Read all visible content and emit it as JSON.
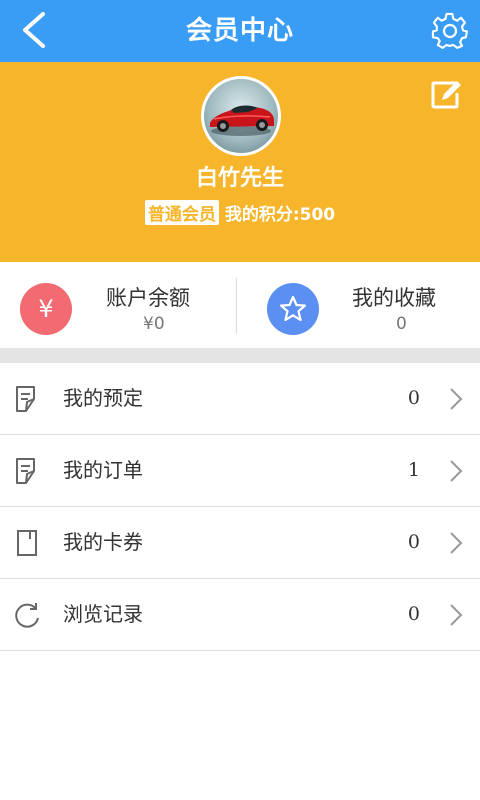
{
  "header": {
    "title": "会员中心",
    "back_icon": "chevron-left-icon",
    "settings_icon": "gear-icon",
    "bg_color": "#3a9df5"
  },
  "profile": {
    "bg_color": "#f7b52c",
    "username": "白竹先生",
    "member_level": "普通会员",
    "points_text": "我的积分:500",
    "edit_icon": "edit-icon"
  },
  "stats": {
    "balance": {
      "label": "账户余额",
      "value": "¥0",
      "icon": "yen-icon",
      "color": "#f26b72"
    },
    "favorites": {
      "label": "我的收藏",
      "value": "0",
      "icon": "star-icon",
      "color": "#5b8ff2"
    }
  },
  "menu": {
    "items": [
      {
        "label": "我的预定",
        "count": "0",
        "icon": "document-icon"
      },
      {
        "label": "我的订单",
        "count": "1",
        "icon": "document-icon"
      },
      {
        "label": "我的卡券",
        "count": "0",
        "icon": "card-icon"
      },
      {
        "label": "浏览记录",
        "count": "0",
        "icon": "refresh-icon"
      }
    ]
  }
}
